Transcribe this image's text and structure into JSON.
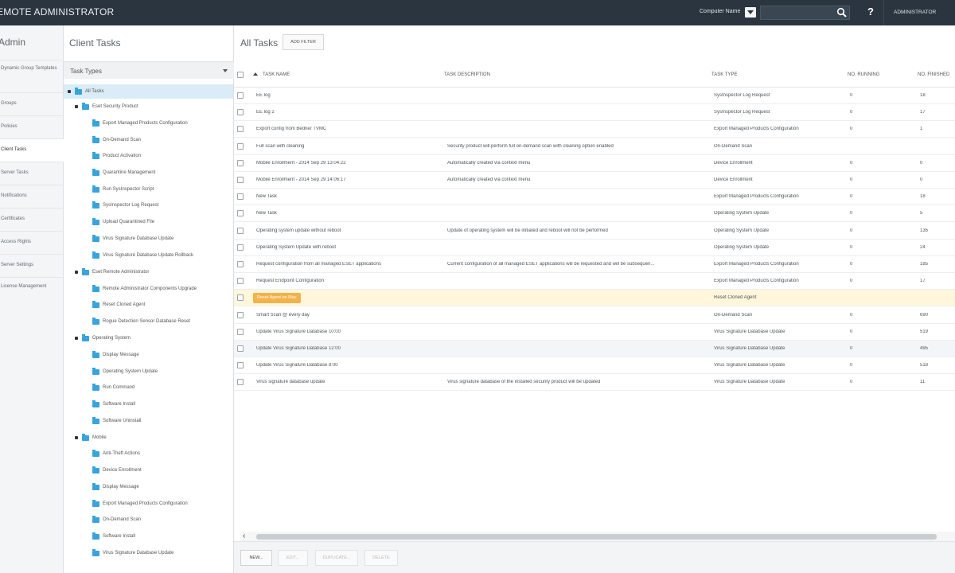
{
  "app": {
    "title": "EMOTE ADMINISTRATOR",
    "computer_name_label": "Computer Name",
    "help": "?",
    "user": "ADMINISTRATOR"
  },
  "admin": {
    "heading": "Admin",
    "items": [
      {
        "label": "Dynamic Group Templates"
      },
      {
        "label": "Groups"
      },
      {
        "label": "Policies"
      },
      {
        "label": "Client Tasks"
      },
      {
        "label": "Server Tasks"
      },
      {
        "label": "Notifications"
      },
      {
        "label": "Certificates"
      },
      {
        "label": "Access Rights"
      },
      {
        "label": "Server Settings"
      },
      {
        "label": "License Management"
      }
    ],
    "copyright": "©"
  },
  "client_tasks": {
    "heading": "Client Tasks",
    "task_types_label": "Task Types",
    "tree": [
      {
        "label": "All Tasks"
      },
      {
        "label": "Eset Security Product"
      },
      {
        "label": "Export Managed Products Configuration"
      },
      {
        "label": "On-Demand Scan"
      },
      {
        "label": "Product Activation"
      },
      {
        "label": "Quarantine Management"
      },
      {
        "label": "Run SysInspector Script"
      },
      {
        "label": "SysInspector Log Request"
      },
      {
        "label": "Upload Quarantined File"
      },
      {
        "label": "Virus Signature Database Update"
      },
      {
        "label": "Virus Signature Database Update Rollback"
      },
      {
        "label": "Eset Remote Administrator"
      },
      {
        "label": "Remote Administrator Components Upgrade"
      },
      {
        "label": "Reset Cloned Agent"
      },
      {
        "label": "Rogue Detection Sensor Database Reset"
      },
      {
        "label": "Operating System"
      },
      {
        "label": "Display Message"
      },
      {
        "label": "Operating System Update"
      },
      {
        "label": "Run Command"
      },
      {
        "label": "Software Install"
      },
      {
        "label": "Software Uninstall"
      },
      {
        "label": "Mobile"
      },
      {
        "label": "Anti-Theft Actions"
      },
      {
        "label": "Device Enrollment"
      },
      {
        "label": "Display Message"
      },
      {
        "label": "Export Managed Products Configuration"
      },
      {
        "label": "On-Demand Scan"
      },
      {
        "label": "Software Install"
      },
      {
        "label": "Virus Signature Database Update"
      }
    ]
  },
  "main": {
    "heading": "All Tasks",
    "add_filter": "ADD FILTER",
    "columns": [
      "TASK NAME",
      "TASK DESCRIPTION",
      "TASK TYPE",
      "NO. RUNNING",
      "NO. FINISHED"
    ],
    "rows": [
      {
        "name": "EE log",
        "desc": "",
        "type": "SysInspector Log Request",
        "running": "0",
        "finished": "18"
      },
      {
        "name": "EE log 2",
        "desc": "",
        "type": "SysInspector Log Request",
        "running": "0",
        "finished": "17"
      },
      {
        "name": "Export config from Bedner TVMC",
        "desc": "",
        "type": "Export Managed Products Configuration",
        "running": "0",
        "finished": "1"
      },
      {
        "name": "Full scan with cleaning",
        "desc": "Security product will perform full on-demand scan with cleaning option enabled",
        "type": "On-Demand Scan",
        "running": "",
        "finished": ""
      },
      {
        "name": "Mobile Enrollment - 2014 Sep 29 13:04:22",
        "desc": "Automatically created via context menu",
        "type": "Device Enrollment",
        "running": "0",
        "finished": "0"
      },
      {
        "name": "Mobile Enrollment - 2014 Sep 29 14:06:17",
        "desc": "Automatically created via context menu",
        "type": "Device Enrollment",
        "running": "0",
        "finished": "0"
      },
      {
        "name": "New Task",
        "desc": "",
        "type": "Export Managed Products Configuration",
        "running": "0",
        "finished": "18"
      },
      {
        "name": "New Task",
        "desc": "",
        "type": "Operating System Update",
        "running": "0",
        "finished": "5"
      },
      {
        "name": "Operating system update without reboot",
        "desc": "Update of operating system will be initiated and reboot will not be performed",
        "type": "Operating System Update",
        "running": "0",
        "finished": "135"
      },
      {
        "name": "Operating System Update with reboot",
        "desc": "",
        "type": "Operating System Update",
        "running": "0",
        "finished": "24"
      },
      {
        "name": "Request configuration from all managed ESET applications",
        "desc": "Current configuration of all managed ESET applications will be requested and will be subsequen...",
        "type": "Export Managed Products Configuration",
        "running": "0",
        "finished": "185"
      },
      {
        "name": "Request Endpoint Configuration",
        "desc": "",
        "type": "Export Managed Products Configuration",
        "running": "0",
        "finished": "17"
      },
      {
        "name": "Reset Agent on Mac",
        "desc": "",
        "type": "Reset Cloned Agent",
        "running": "",
        "finished": "",
        "selected": true
      },
      {
        "name": "Smart Scan @ every day",
        "desc": "",
        "type": "On-Demand Scan",
        "running": "0",
        "finished": "690"
      },
      {
        "name": "Update Virus Signature Database 10:00",
        "desc": "",
        "type": "Virus Signature Database Update",
        "running": "0",
        "finished": "519"
      },
      {
        "name": "Update Virus Signature Database 12:00",
        "desc": "",
        "type": "Virus Signature Database Update",
        "running": "0",
        "finished": "495"
      },
      {
        "name": "Update Virus Signature Database 8:00",
        "desc": "",
        "type": "Virus Signature Database Update",
        "running": "0",
        "finished": "518"
      },
      {
        "name": "Virus signature database update",
        "desc": "Virus signature database of the installed security product will be updated",
        "type": "Virus Signature Database Update",
        "running": "0",
        "finished": "11"
      }
    ],
    "footer_buttons": [
      {
        "label": "NEW...",
        "enabled": true
      },
      {
        "label": "EDIT...",
        "enabled": false
      },
      {
        "label": "DUPLICATE...",
        "enabled": false
      },
      {
        "label": "DELETE",
        "enabled": false
      }
    ],
    "colors": {
      "selected_row": "#fff6dc",
      "tag": "#f3b24a",
      "folder": "#38a3dc",
      "topbar": "#2b3540"
    }
  }
}
